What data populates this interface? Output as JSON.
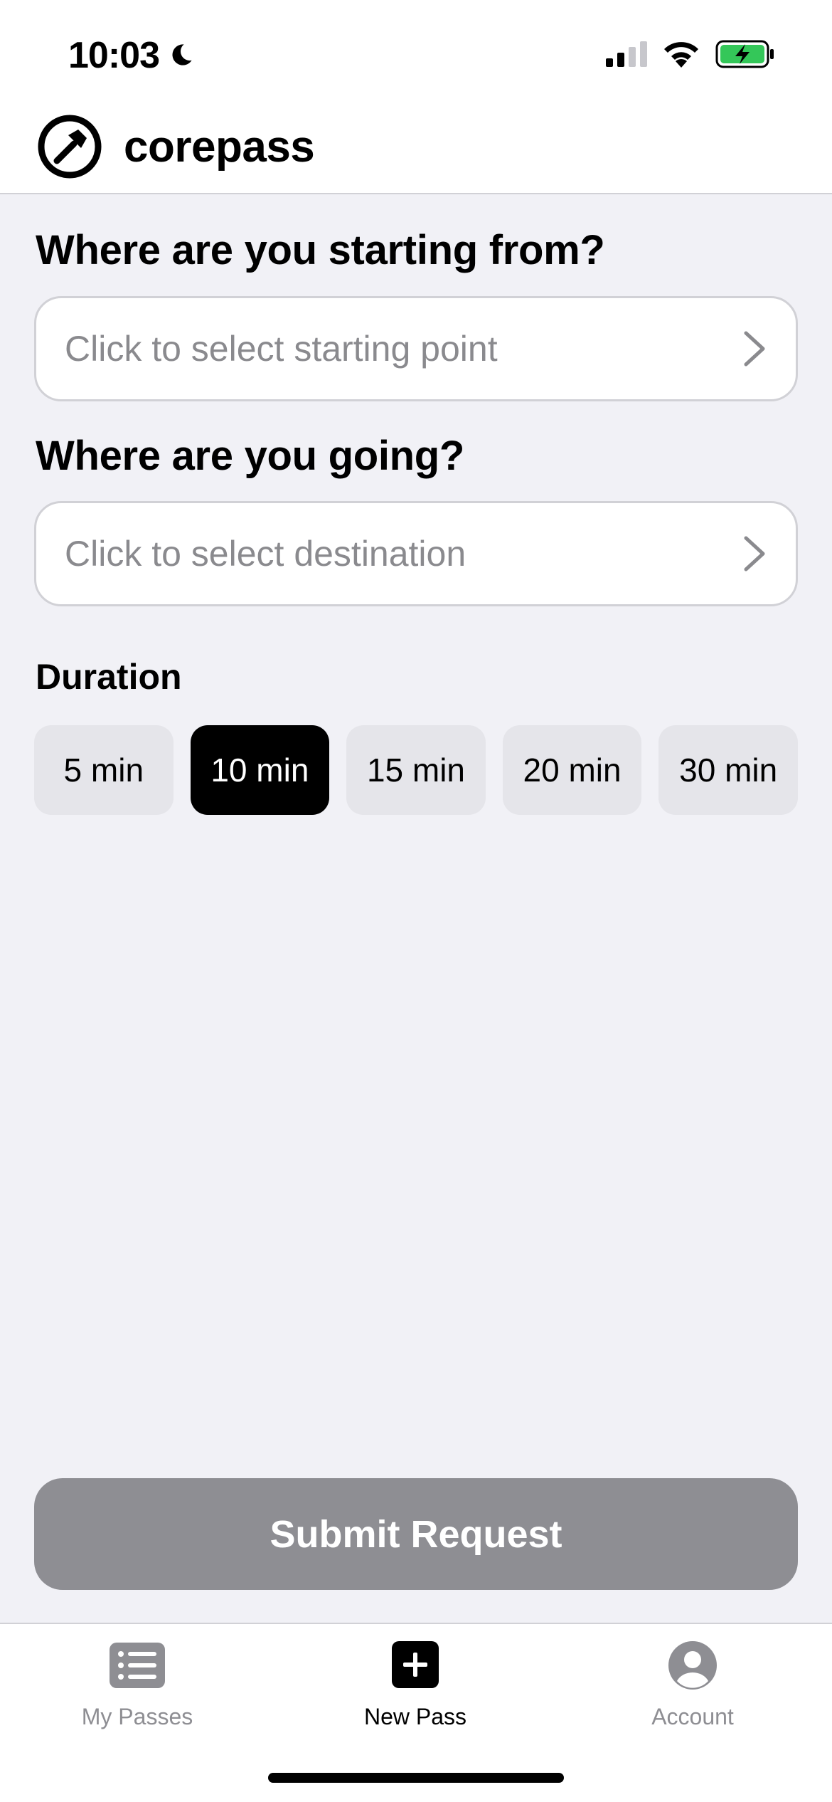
{
  "status_bar": {
    "time": "10:03"
  },
  "header": {
    "app_name": "corepass"
  },
  "form": {
    "start_label": "Where are you starting from?",
    "start_placeholder": "Click to select starting point",
    "dest_label": "Where are you going?",
    "dest_placeholder": "Click to select destination",
    "duration_label": "Duration",
    "durations": [
      "5 min",
      "10 min",
      "15 min",
      "20 min",
      "30 min"
    ],
    "selected_duration": "10 min"
  },
  "submit_label": "Submit Request",
  "tabs": [
    {
      "label": "My Passes",
      "icon": "list-icon",
      "active": false
    },
    {
      "label": "New Pass",
      "icon": "plus-square-icon",
      "active": true
    },
    {
      "label": "Account",
      "icon": "person-circle-icon",
      "active": false
    }
  ],
  "colors": {
    "background": "#f1f1f6",
    "selected": "#000000",
    "disabled_button": "#8e8e93",
    "battery_green": "#34c759"
  }
}
